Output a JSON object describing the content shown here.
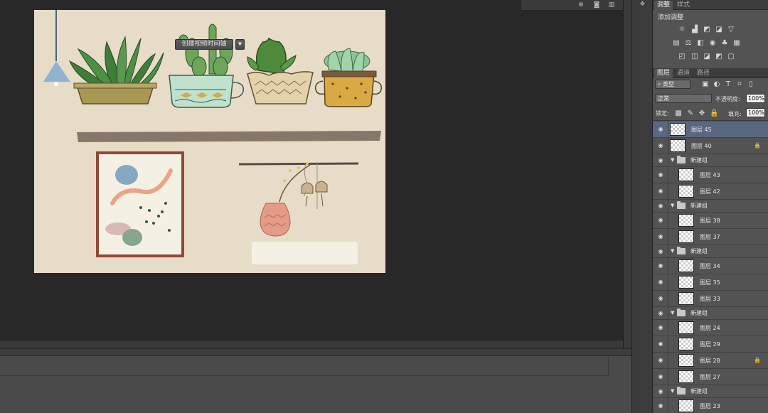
{
  "adjustments_panel": {
    "tabs": [
      "调整",
      "样式"
    ],
    "title": "添加调整"
  },
  "layers_panel": {
    "tabs": [
      "图层",
      "通道",
      "路径"
    ],
    "filter_kind": "类型",
    "blend_mode": "正常",
    "opacity_label": "不透明度:",
    "opacity_value": "100%",
    "lock_label": "锁定:",
    "fill_label": "填充:",
    "fill_value": "100%",
    "rows": [
      {
        "type": "layer",
        "name": "图层 45",
        "selected": true,
        "locked": false,
        "indent": 0
      },
      {
        "type": "layer",
        "name": "图层 40",
        "selected": false,
        "locked": true,
        "indent": 0
      },
      {
        "type": "group",
        "name": "新建组"
      },
      {
        "type": "layer",
        "name": "图层 43",
        "selected": false,
        "locked": false,
        "indent": 1
      },
      {
        "type": "layer",
        "name": "图层 42",
        "selected": false,
        "locked": false,
        "indent": 1
      },
      {
        "type": "group",
        "name": "新建组"
      },
      {
        "type": "layer",
        "name": "图层 38",
        "selected": false,
        "locked": false,
        "indent": 1
      },
      {
        "type": "layer",
        "name": "图层 37",
        "selected": false,
        "locked": false,
        "indent": 1
      },
      {
        "type": "group",
        "name": "新建组"
      },
      {
        "type": "layer",
        "name": "图层 34",
        "selected": false,
        "locked": false,
        "indent": 1
      },
      {
        "type": "layer",
        "name": "图层 35",
        "selected": false,
        "locked": false,
        "indent": 1
      },
      {
        "type": "layer",
        "name": "图层 33",
        "selected": false,
        "locked": false,
        "indent": 1
      },
      {
        "type": "group",
        "name": "新建组"
      },
      {
        "type": "layer",
        "name": "图层 24",
        "selected": false,
        "locked": false,
        "indent": 1
      },
      {
        "type": "layer",
        "name": "图层 29",
        "selected": false,
        "locked": false,
        "indent": 1
      },
      {
        "type": "layer",
        "name": "图层 28",
        "selected": false,
        "locked": true,
        "indent": 1
      },
      {
        "type": "layer",
        "name": "图层 27",
        "selected": false,
        "locked": false,
        "indent": 1
      },
      {
        "type": "group",
        "name": "新建组"
      },
      {
        "type": "layer",
        "name": "图层 23",
        "selected": false,
        "locked": false,
        "indent": 1
      }
    ]
  },
  "timeline": {
    "create_button": "创建视频时间轴",
    "dropdown_icon": "chevron-down-icon"
  },
  "colors": {
    "canvas_bg": "#e6dcc7",
    "selected_layer": "#5a6780",
    "panel_bg": "#535353"
  }
}
